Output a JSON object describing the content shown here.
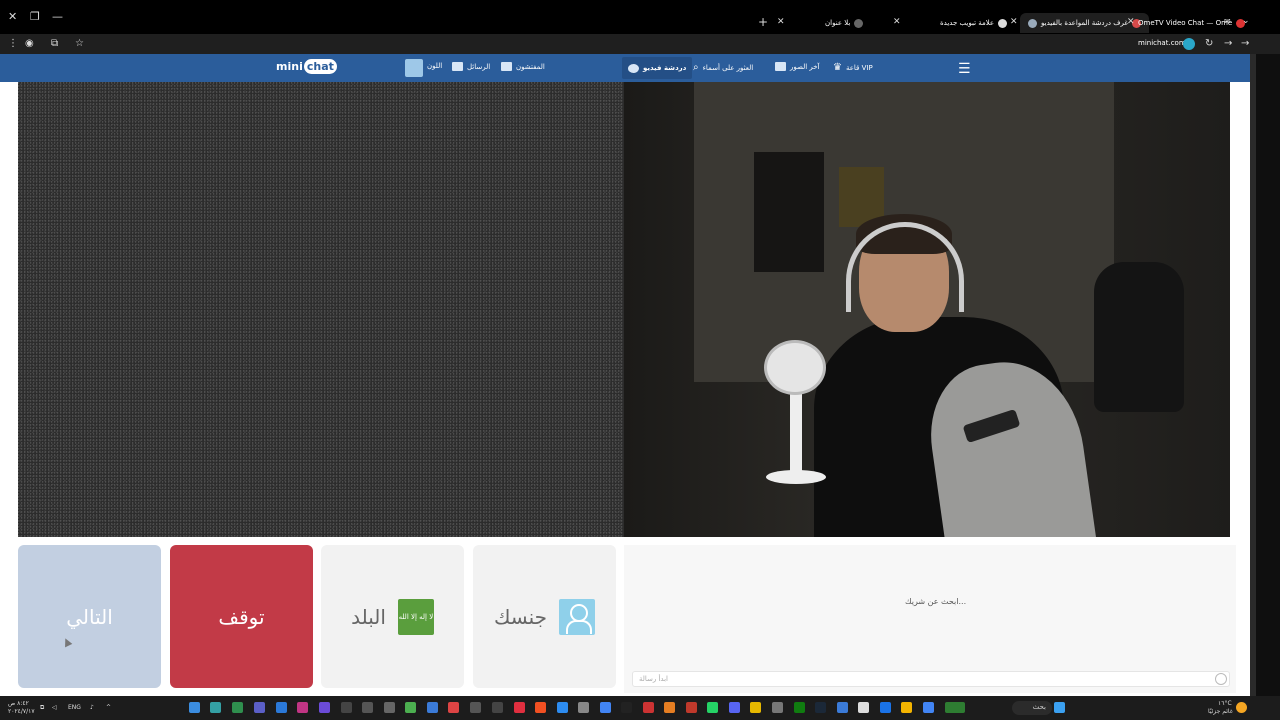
{
  "browser": {
    "tabs": [
      {
        "title": "OmeTV Video Chat — Ome",
        "active": false
      },
      {
        "title": "غرف دردشة المواعدة بالفيديو",
        "active": true
      },
      {
        "title": "علامة تبويب جديدة",
        "active": false
      },
      {
        "title": "بلا عنوان",
        "active": false
      }
    ],
    "url": "minichat.com"
  },
  "site": {
    "logo_mini": "mini",
    "logo_chat": "chat",
    "nav": {
      "video_chat": "دردشة فيديو",
      "find_by_name": "العثور على أسماء",
      "latest_photos": "آخر الصور",
      "vip_hall": "قاعة VIP",
      "inspectors": "المفتشون",
      "messages": "الرسائل",
      "color": "اللون"
    }
  },
  "controls": {
    "next": "التالي",
    "stop": "توقف",
    "country": "البلد",
    "country_flag_text": "لا إله إلا الله",
    "gender": "جنسك"
  },
  "chat": {
    "status": "...ابحث عن شريك",
    "input_placeholder": "ابدأ رسالة"
  },
  "taskbar": {
    "search": "بحث",
    "lang": "ENG",
    "weather_temp": "١٦°C",
    "weather_desc": "غائم جزئيًا",
    "time": "٨:٤٢ ص",
    "date": "٢٠٢٤/٧/١٧"
  },
  "colors": {
    "navbar": "#2b5d9b",
    "next_button": "#c2cfe1",
    "stop_button": "#c23a47",
    "gender_icon": "#8fd0ea",
    "flag": "#5a9e3d"
  }
}
